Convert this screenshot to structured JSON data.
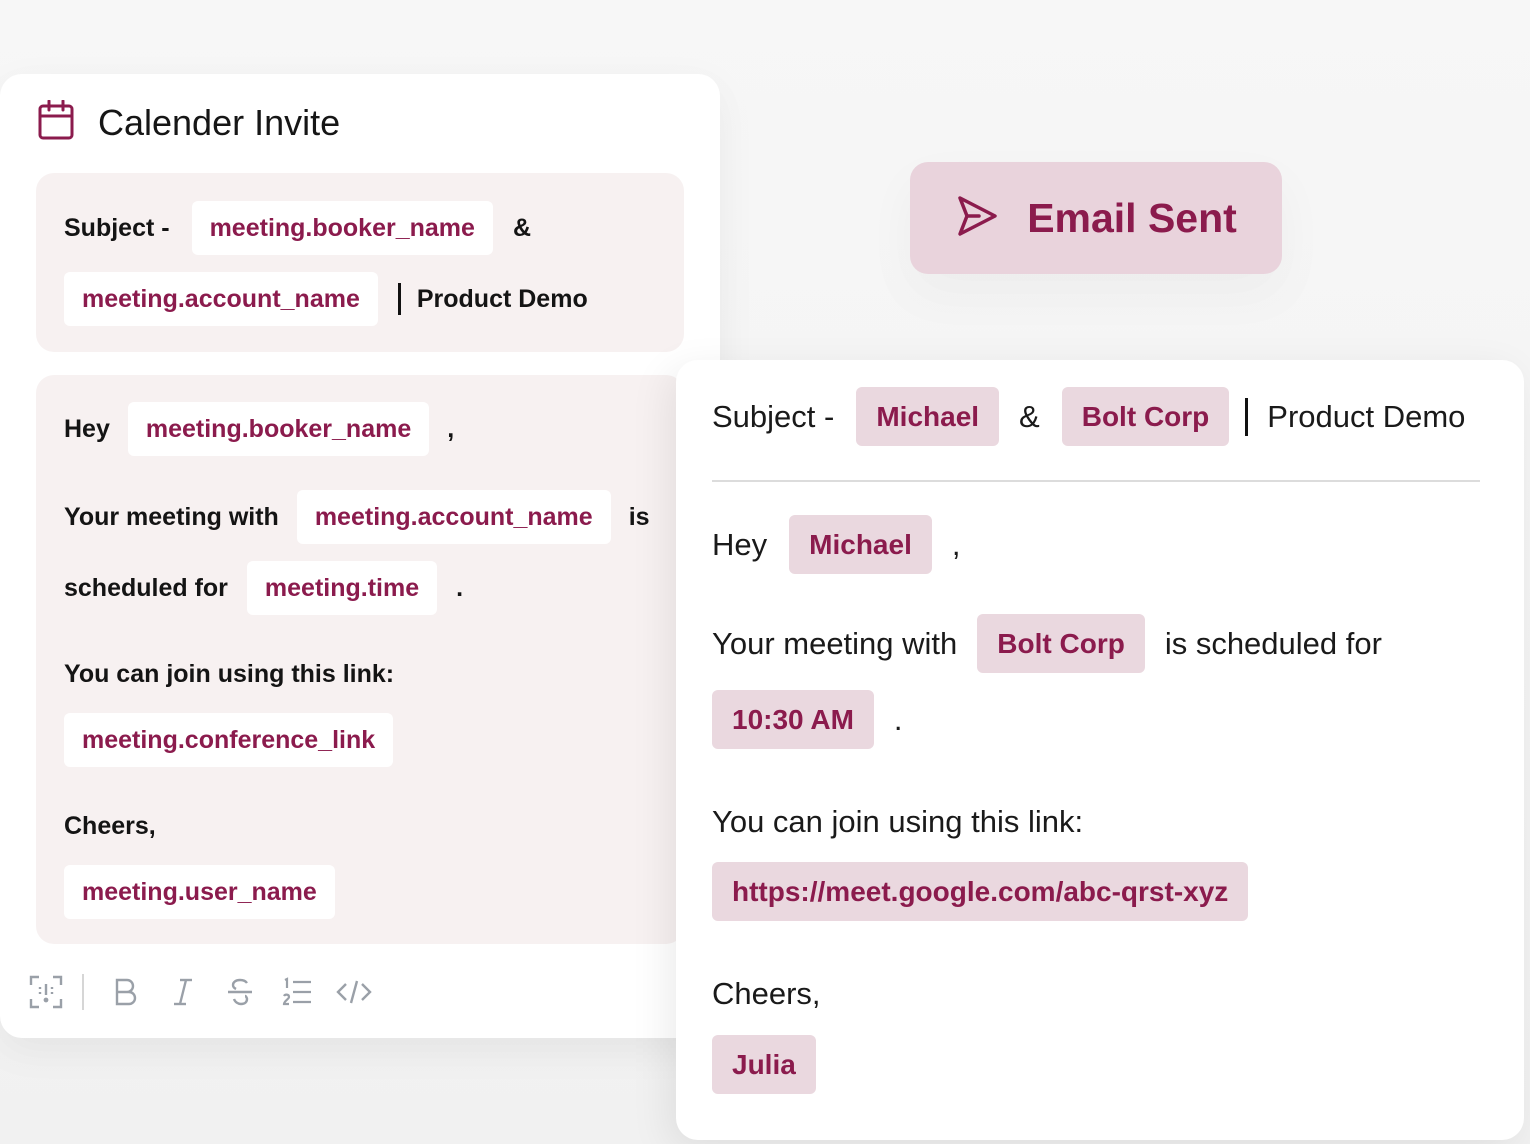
{
  "editor": {
    "title": "Calender Invite",
    "subject": {
      "prefix": "Subject -",
      "var_booker": "meeting.booker_name",
      "amp": "&",
      "var_account": "meeting.account_name",
      "suffix": "Product Demo"
    },
    "body": {
      "hey": "Hey",
      "var_booker": "meeting.booker_name",
      "comma": ",",
      "meeting_with": "Your meeting with",
      "var_account": "meeting.account_name",
      "is": "is",
      "scheduled_for": "scheduled for",
      "var_time": "meeting.time",
      "period": ".",
      "join_text": "You can join using this link:",
      "var_link": "meeting.conference_link",
      "cheers": "Cheers,",
      "var_user": "meeting.user_name"
    },
    "toolbar": [
      "variable-icon",
      "bold-icon",
      "italic-icon",
      "strikethrough-icon",
      "numbered-list-icon",
      "code-icon"
    ]
  },
  "sent_button": {
    "label": "Email Sent",
    "icon": "send-icon"
  },
  "preview": {
    "subject": {
      "prefix": "Subject -",
      "booker": "Michael",
      "amp": "&",
      "account": "Bolt Corp",
      "suffix": "Product Demo"
    },
    "body": {
      "hey": "Hey",
      "booker": "Michael",
      "comma": ",",
      "meeting_with": "Your meeting with",
      "account": "Bolt Corp",
      "scheduled_for": "is scheduled for",
      "time": "10:30 AM",
      "period": ".",
      "join_text": "You can join using this link:",
      "link": "https://meet.google.com/abc-qrst-xyz",
      "cheers": "Cheers,",
      "user": "Julia"
    }
  },
  "colors": {
    "accent": "#8b1b4d",
    "chip_bg_preview": "#ead8df",
    "panel_bg": "#f7f1f1",
    "button_bg": "#e9d3dc"
  }
}
